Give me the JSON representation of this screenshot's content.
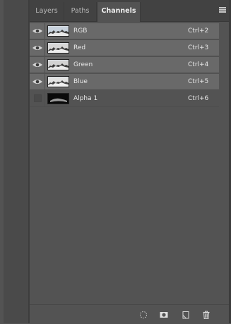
{
  "tabs": [
    {
      "label": "Layers"
    },
    {
      "label": "Paths"
    },
    {
      "label": "Channels"
    }
  ],
  "channels": [
    {
      "name": "RGB",
      "shortcut": "Ctrl+2",
      "visible": true
    },
    {
      "name": "Red",
      "shortcut": "Ctrl+3",
      "visible": true
    },
    {
      "name": "Green",
      "shortcut": "Ctrl+4",
      "visible": true
    },
    {
      "name": "Blue",
      "shortcut": "Ctrl+5",
      "visible": true
    },
    {
      "name": "Alpha 1",
      "shortcut": "Ctrl+6",
      "visible": false
    }
  ],
  "bottom_icons": [
    "load-selection-icon",
    "save-selection-icon",
    "new-channel-icon",
    "trash-icon"
  ],
  "colors": {
    "panel_bg": "#535353",
    "selected_row": "#696969",
    "tabbar_bg": "#424242",
    "text": "#e8e8e8"
  }
}
